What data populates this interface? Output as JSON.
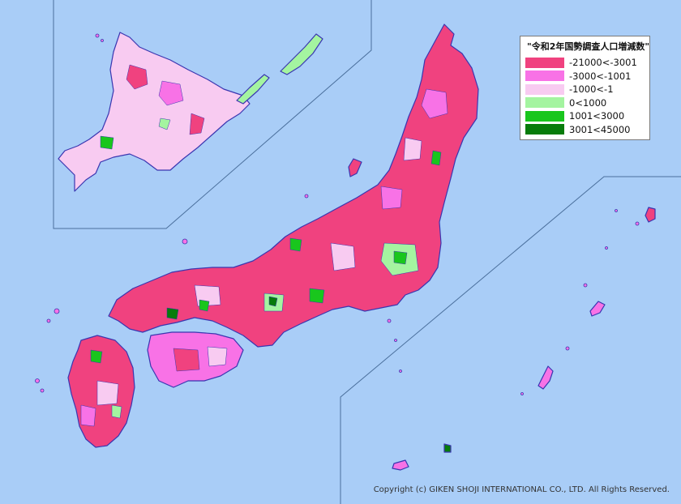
{
  "legend": {
    "title": "\"令和2年国勢調査人口増減数\"",
    "items": [
      {
        "label": "-21000<-3001",
        "color": "#f0427f"
      },
      {
        "label": "-3000<-1001",
        "color": "#f872e6"
      },
      {
        "label": "-1000<-1",
        "color": "#f8cbf1"
      },
      {
        "label": "0<1000",
        "color": "#a4f4a0"
      },
      {
        "label": "1001<3000",
        "color": "#19c61d"
      },
      {
        "label": "3001<45000",
        "color": "#077c0b"
      }
    ]
  },
  "copyright": "Copyright (c) GIKEN SHOJI INTERNATIONAL CO., LTD. All Rights Reserved.",
  "colors": {
    "sea": "#a9cdf7",
    "inset_line": "#4a6f9c",
    "boundary": "#3a36b0"
  }
}
